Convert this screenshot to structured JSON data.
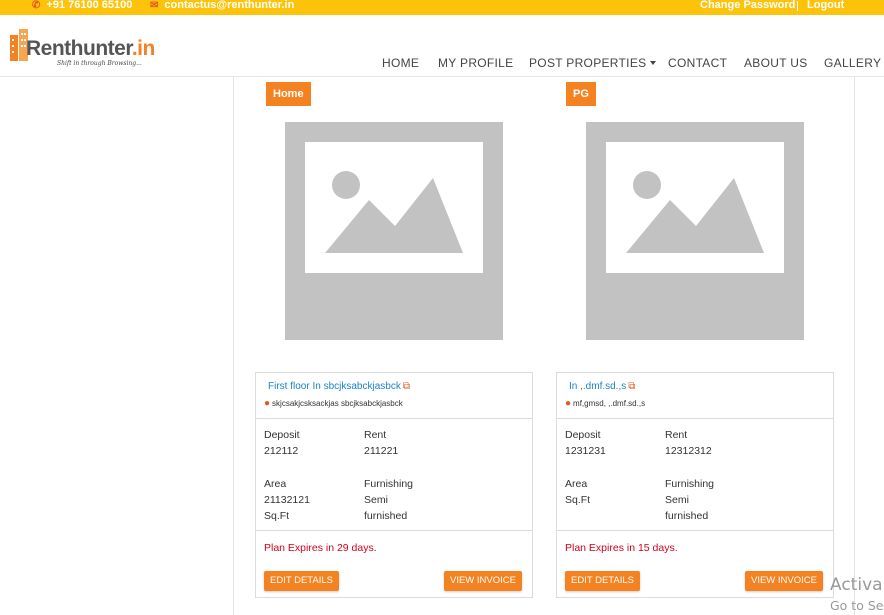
{
  "topbar": {
    "phone": "+91 76100 65100",
    "email": "contactus@renthunter.in",
    "change_password": "Change Password",
    "logout": "Logout"
  },
  "logo": {
    "brand_main": "Renthunter",
    "brand_accent": ".in",
    "tagline": "Shift in through Browsing..."
  },
  "nav": {
    "home": "HOME",
    "my_profile": "MY PROFILE",
    "post_properties": "POST PROPERTIES",
    "contact": "CONTACT",
    "about_us": "ABOUT US",
    "gallery": "GALLERY"
  },
  "cards": [
    {
      "type_badge": "Home",
      "title": "First floor In sbcjksabckjasbck",
      "address": "skjcsakjcsksackjas sbcjksabckjasbck",
      "deposit_label": "Deposit",
      "deposit_value": "212112",
      "rent_label": "Rent",
      "rent_value": "211221",
      "area_label": "Area",
      "area_value": "21132121",
      "area_unit": "Sq.Ft",
      "furnishing_label": "Furnishing",
      "furnishing_value_1": "Semi",
      "furnishing_value_2": "furnished",
      "plan_expiry": "Plan Expires in 29 days.",
      "edit_label": "EDIT DETAILS",
      "invoice_label": "VIEW INVOICE"
    },
    {
      "type_badge": "PG",
      "title": "In ,.dmf.sd.,s",
      "address": "mf,gmsd, ,.dmf.sd.,s",
      "deposit_label": "Deposit",
      "deposit_value": "1231231",
      "rent_label": "Rent",
      "rent_value": "12312312",
      "area_label": "Area",
      "area_value": "",
      "area_unit": "Sq.Ft",
      "furnishing_label": "Furnishing",
      "furnishing_value_1": "Semi",
      "furnishing_value_2": "furnished",
      "plan_expiry": "Plan Expires in 15 days.",
      "edit_label": "EDIT DETAILS",
      "invoice_label": "VIEW INVOICE"
    }
  ],
  "watermark": {
    "line1": "Activa",
    "line2": "Go to Se"
  },
  "colors": {
    "topbar_bg": "#fdc30b",
    "accent": "#f58220",
    "link": "#1a84c7",
    "expiry": "#d0021b",
    "placeholder": "#c2c2c2"
  },
  "icons": {
    "phone": "phone-icon",
    "email": "envelope-icon",
    "external": "external-link-icon",
    "location": "map-marker-icon",
    "placeholder": "image-placeholder-icon"
  }
}
